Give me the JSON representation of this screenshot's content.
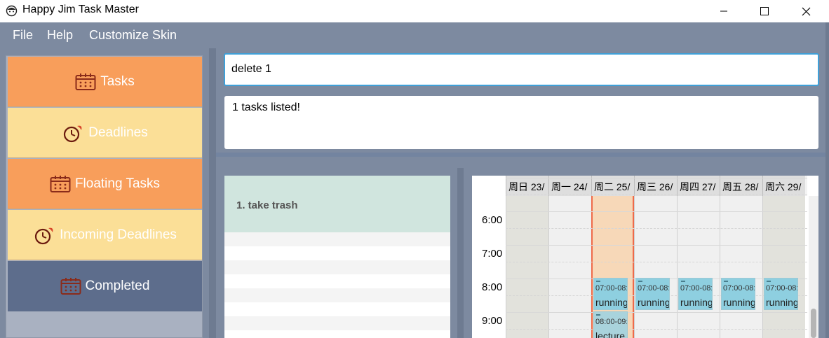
{
  "window": {
    "title": "Happy Jim Task Master"
  },
  "menu": {
    "items": [
      "File",
      "Help",
      "Customize Skin"
    ]
  },
  "sidebar": {
    "items": [
      {
        "label": "Tasks",
        "icon": "calendar-icon"
      },
      {
        "label": "Deadlines",
        "icon": "clock-icon"
      },
      {
        "label": "Floating Tasks",
        "icon": "calendar-icon"
      },
      {
        "label": "Incoming Deadlines",
        "icon": "clock-icon"
      },
      {
        "label": "Completed",
        "icon": "calendar-icon"
      }
    ]
  },
  "command": {
    "value": "delete 1"
  },
  "result": {
    "text": "1 tasks listed!"
  },
  "task_list": {
    "items": [
      {
        "label": "1. take trash"
      }
    ]
  },
  "calendar": {
    "days": [
      "周日 23/",
      "周一 24/",
      "周二 25/",
      "周三 26/",
      "周四 27/",
      "周五 28/",
      "周六 29/"
    ],
    "times": [
      "6:00",
      "7:00",
      "8:00",
      "9:00"
    ],
    "events": [
      {
        "day": 2,
        "time": "07:00-08:0",
        "name": "running"
      },
      {
        "day": 3,
        "time": "07:00-08:0",
        "name": "running"
      },
      {
        "day": 4,
        "time": "07:00-08:0",
        "name": "running"
      },
      {
        "day": 5,
        "time": "07:00-08:0",
        "name": "running"
      },
      {
        "day": 6,
        "time": "07:00-08:0",
        "name": "running"
      },
      {
        "day": 2,
        "time": "08:00-09:0",
        "name": "lecture"
      }
    ]
  },
  "colors": {
    "accent": "#3fa0d8",
    "tab_orange": "#f89e5b",
    "tab_yellow": "#fbdf97",
    "tab_blue": "#5d6d8c",
    "event": "#8ecfe0",
    "today": "#ef6a4a"
  }
}
